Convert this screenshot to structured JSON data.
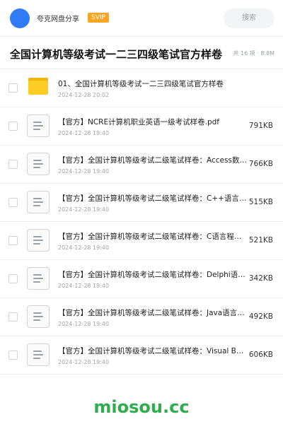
{
  "header": {
    "user_name": "夸克网盘分享",
    "badge": "SVIP",
    "search_label": "搜索"
  },
  "title_row": {
    "title": "全国计算机等级考试一二三四级笔试官方样卷",
    "meta": "共 16 项 · 8.8M"
  },
  "items": [
    {
      "type": "folder",
      "name": "01、全国计算机等级考试一二三四级笔试官方样卷",
      "date": "2024-12-28 20:02",
      "size": ""
    },
    {
      "type": "file",
      "name": "【官方】NCRE计算机职业英语一级考试样卷.pdf",
      "date": "2024-12-28 19:40",
      "size": "791KB"
    },
    {
      "type": "file",
      "name": "【官方】全国计算机等级考试二级笔试样卷：Access数据库程序设计.pdf",
      "date": "2024-12-28 19:40",
      "size": "766KB"
    },
    {
      "type": "file",
      "name": "【官方】全国计算机等级考试二级笔试样卷：C++语言程序设计.pdf",
      "date": "2024-12-28 19:40",
      "size": "515KB"
    },
    {
      "type": "file",
      "name": "【官方】全国计算机等级考试二级笔试样卷：C语言程序设计.pdf",
      "date": "2024-12-28 19:40",
      "size": "521KB"
    },
    {
      "type": "file",
      "name": "【官方】全国计算机等级考试二级笔试样卷：Delphi语言程序设计.pdf",
      "date": "2024-12-28 19:40",
      "size": "342KB"
    },
    {
      "type": "file",
      "name": "【官方】全国计算机等级考试二级笔试样卷：Java语言程序设计.pdf",
      "date": "2024-12-28 19:40",
      "size": "492KB"
    },
    {
      "type": "file",
      "name": "【官方】全国计算机等级考试二级笔试样卷：Visual Basic语言程序设计.pdf",
      "date": "2024-12-28 19:40",
      "size": "606KB"
    }
  ],
  "watermark": "miosou.cc",
  "colors": {
    "accent": "#2f7cf6",
    "badge": "#f6a623",
    "folder": "#fdcc25",
    "watermark": "#2eae4b"
  }
}
